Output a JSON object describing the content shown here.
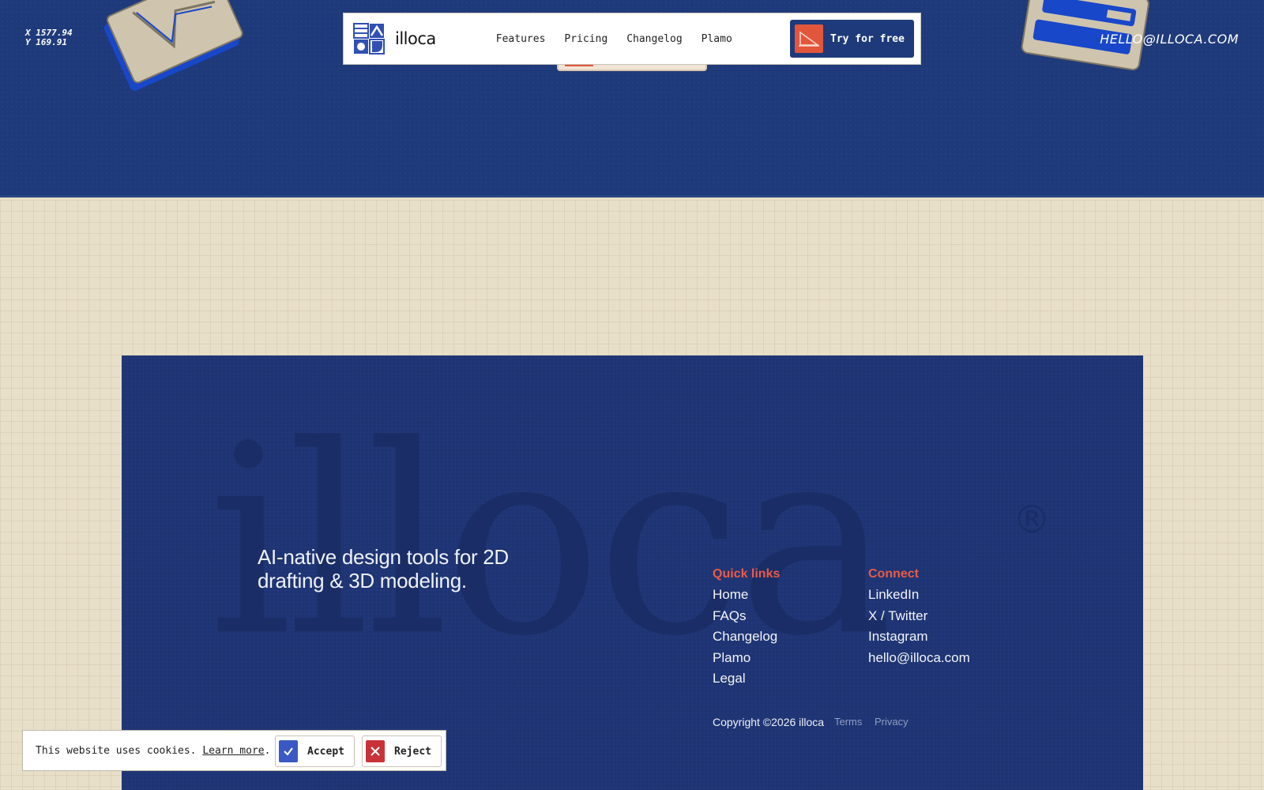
{
  "cursor": {
    "x_label": "X 1577.94",
    "y_label": "Y 169.91"
  },
  "top_email": "HELLO@ILLOCA.COM",
  "navbar": {
    "brand": "illoca",
    "links": [
      "Features",
      "Pricing",
      "Changelog",
      "Plamo"
    ],
    "cta_label": "Try for free"
  },
  "footer": {
    "wordmark": "illoca",
    "wordmark_reg": "®",
    "tagline": "AI-native design tools for 2D drafting & 3D modeling.",
    "quick_links": {
      "title": "Quick links",
      "items": [
        "Home",
        "FAQs",
        "Changelog",
        "Plamo",
        "Legal"
      ]
    },
    "connect": {
      "title": "Connect",
      "items": [
        "LinkedIn",
        "X / Twitter",
        "Instagram",
        "hello@illoca.com"
      ]
    },
    "copyright": "Copyright ©2026 illoca",
    "terms": "Terms",
    "privacy": "Privacy"
  },
  "cookie": {
    "text": "This website uses cookies.",
    "learn_more": "Learn more",
    "period": ".",
    "accept": "Accept",
    "reject": "Reject"
  },
  "colors": {
    "navy": "#1f3a7a",
    "accent_orange": "#e2563b",
    "paper": "#e8dfc8",
    "accept_blue": "#3b59c4",
    "reject_red": "#c8333a"
  },
  "icons": [
    "logo-mark-icon",
    "drafting-triangle-icon",
    "check-icon",
    "close-icon"
  ]
}
